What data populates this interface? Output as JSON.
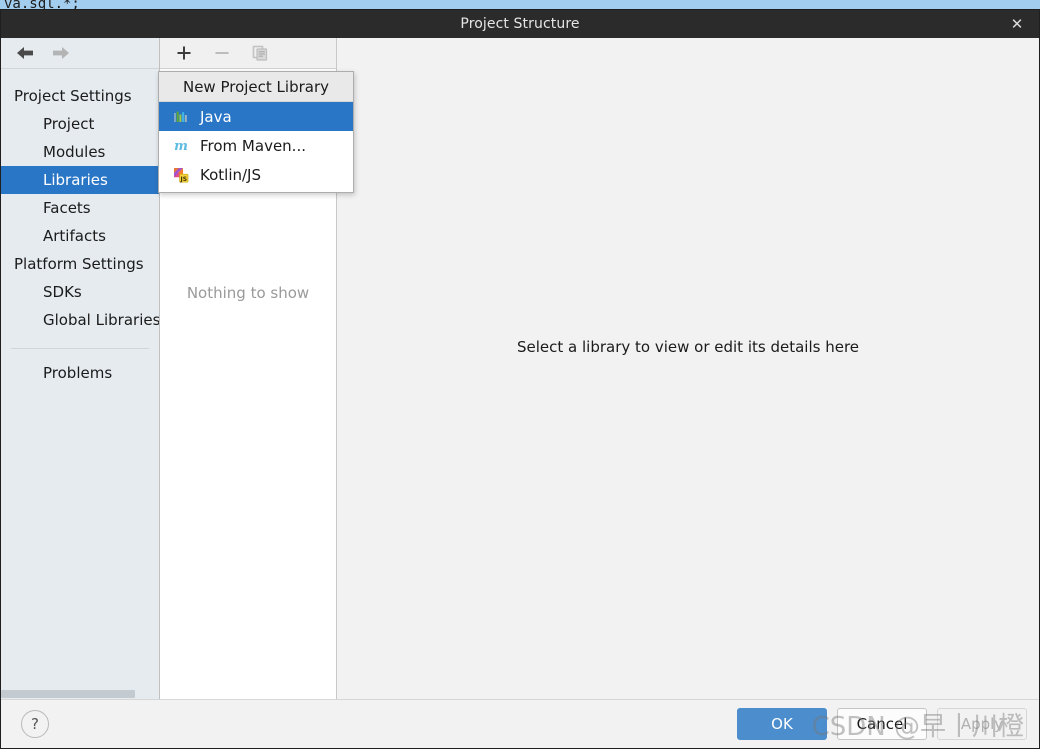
{
  "background": {
    "code_line": "va.sql.*;"
  },
  "dialog": {
    "title": "Project Structure",
    "close_label": "✕"
  },
  "nav": {
    "back_icon": "arrow-left-icon",
    "forward_icon": "arrow-right-icon"
  },
  "sidebar": {
    "groups": [
      {
        "label": "Project Settings",
        "items": [
          {
            "label": "Project",
            "selected": false
          },
          {
            "label": "Modules",
            "selected": false
          },
          {
            "label": "Libraries",
            "selected": true
          },
          {
            "label": "Facets",
            "selected": false
          },
          {
            "label": "Artifacts",
            "selected": false
          }
        ]
      },
      {
        "label": "Platform Settings",
        "items": [
          {
            "label": "SDKs",
            "selected": false
          },
          {
            "label": "Global Libraries",
            "selected": false
          }
        ]
      }
    ],
    "footer_items": [
      {
        "label": "Problems",
        "selected": false
      }
    ]
  },
  "toolbar": {
    "add_label": "+",
    "remove_label": "−",
    "copy_label": "copy-icon"
  },
  "mid_panel": {
    "empty_text": "Nothing to show"
  },
  "detail_panel": {
    "empty_text": "Select a library to view or edit its details here"
  },
  "popup": {
    "header": "New Project Library",
    "items": [
      {
        "label": "Java",
        "icon": "java-library-icon",
        "selected": true
      },
      {
        "label": "From Maven...",
        "icon": "maven-icon",
        "selected": false
      },
      {
        "label": "Kotlin/JS",
        "icon": "kotlin-js-icon",
        "selected": false
      }
    ]
  },
  "footer": {
    "help_label": "?",
    "buttons": [
      {
        "label": "OK",
        "style": "primary"
      },
      {
        "label": "Cancel",
        "style": "normal"
      },
      {
        "label": "Apply",
        "style": "disabled"
      }
    ]
  },
  "watermark": {
    "text": "CSDN @早丨川橙"
  },
  "colors": {
    "accent": "#2a76c6",
    "primary_button": "#4b8dcd",
    "titlebar": "#2b2b2b",
    "sidebar_bg": "#e6ebef",
    "dialog_bg": "#f2f2f2"
  }
}
